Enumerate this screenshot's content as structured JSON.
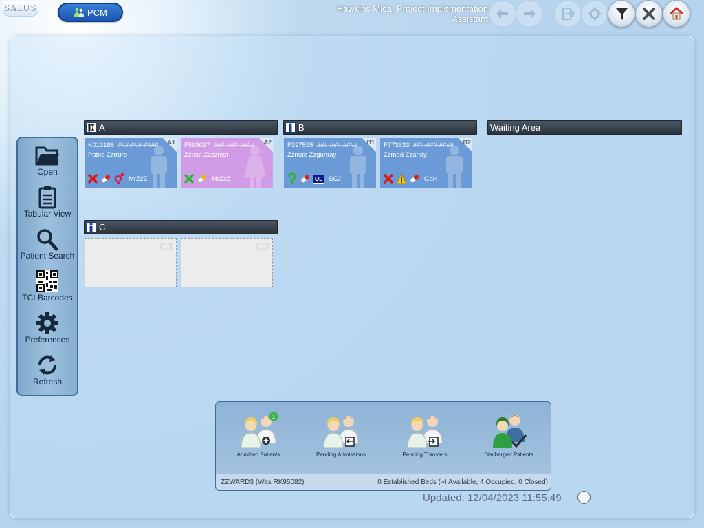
{
  "app": {
    "logo_text": "SALUS",
    "module_button": "PCM",
    "user_title": "Hawkins Mica, Project Implementation Assistant"
  },
  "toolbar": {
    "icons": [
      "back-arrow-icon",
      "forward-arrow-icon",
      "exit-icon",
      "settings-pin-icon",
      "filter-icon",
      "close-icon",
      "home-icon"
    ]
  },
  "sidebar": {
    "items": [
      {
        "label": "Open",
        "icon": "folder-icon"
      },
      {
        "label": "Tabular View",
        "icon": "clipboard-icon"
      },
      {
        "label": "Patient Search",
        "icon": "magnifier-icon"
      },
      {
        "label": "TCI Barcodes",
        "icon": "qr-code-icon"
      },
      {
        "label": "Preferences",
        "icon": "gear-icon"
      },
      {
        "label": "Refresh",
        "icon": "refresh-icon"
      }
    ]
  },
  "bays": {
    "A": {
      "title": "A",
      "icon": "mixed-gender-bay-icon"
    },
    "B": {
      "title": "B",
      "icon": "male-bay-icon"
    },
    "C": {
      "title": "C",
      "icon": "male-bay-icon"
    },
    "waiting": {
      "title": "Waiting Area"
    }
  },
  "beds": {
    "A1": {
      "code": "A1",
      "mrn": "K013188",
      "nhs": "###-###-####",
      "name": "Pablo Zztruro",
      "consultant": "MrZzZ",
      "colour": "#6b9bd6",
      "gender": "male"
    },
    "A2": {
      "code": "A2",
      "mrn": "F599027",
      "nhs": "###-###-####",
      "name": "Zztest Zzzztest",
      "consultant": "MrZzZ",
      "colour": "#d29be6",
      "gender": "female"
    },
    "B1": {
      "code": "B1",
      "mrn": "F397595",
      "nhs": "###-###-####",
      "name": "Zznute Zzgunray",
      "consultant": "SCJ",
      "badge": "OL",
      "colour": "#6b9bd6",
      "gender": "male"
    },
    "B2": {
      "code": "B2",
      "mrn": "F773633",
      "nhs": "###-###-####",
      "name": "Zzmed Zzandy",
      "consultant": "GaH",
      "colour": "#6b9bd6",
      "gender": "male"
    },
    "C1": {
      "code": "C1"
    },
    "C2": {
      "code": "C2"
    }
  },
  "bottom": {
    "buttons": [
      {
        "label": "Admitted Patients",
        "badge": "1"
      },
      {
        "label": "Pending Admissions"
      },
      {
        "label": "Pending Transfers"
      },
      {
        "label": "Discharged Patients"
      }
    ],
    "ward": "ZZWARD3 (Was RK95082)",
    "beds_summary": "0 Established Beds (-4 Available, 4 Occupied, 0 Closed)"
  },
  "status": {
    "updated": "Updated: 12/04/2023 11:55:49"
  }
}
